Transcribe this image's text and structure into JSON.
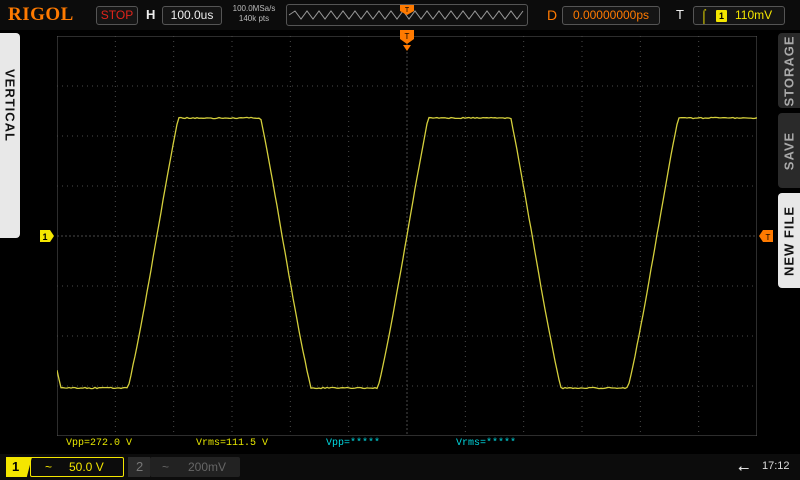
{
  "brand": "RIGOL",
  "run_state": "STOP",
  "horizontal": {
    "label": "H",
    "timebase": "100.0us",
    "sample_rate": "100.0MSa/s",
    "points": "140k pts"
  },
  "delay": {
    "label": "D",
    "value": "0.00000000ps"
  },
  "trigger": {
    "label": "T",
    "edge_icon": "rising-edge-icon",
    "source": "1",
    "level": "110mV"
  },
  "menu_tabs": {
    "vertical": "VERTICAL",
    "storage": "STORAGE",
    "save": "SAVE",
    "new_file": "NEW FILE"
  },
  "markers": {
    "ch1": "1",
    "trigger_marker": "T"
  },
  "measurements": [
    {
      "text": "Vpp=272.0 V",
      "color": "#e6e600"
    },
    {
      "text": "Vrms=111.5 V",
      "color": "#e6e600"
    },
    {
      "text": "Vpp=*****",
      "color": "#00d8e0"
    },
    {
      "text": "Vrms=*****",
      "color": "#00d8e0"
    }
  ],
  "channels": [
    {
      "num": "1",
      "coupling": "~",
      "scale": "50.0 V",
      "active": true
    },
    {
      "num": "2",
      "coupling": "~",
      "scale": "200mV",
      "active": false
    }
  ],
  "status": {
    "time": "17:12",
    "usb_icon": "usb-icon"
  },
  "colors": {
    "ch1": "#f4e600",
    "accent": "#ff7a00",
    "ch2": "#00d8e0",
    "stop": "#e0241b"
  }
}
